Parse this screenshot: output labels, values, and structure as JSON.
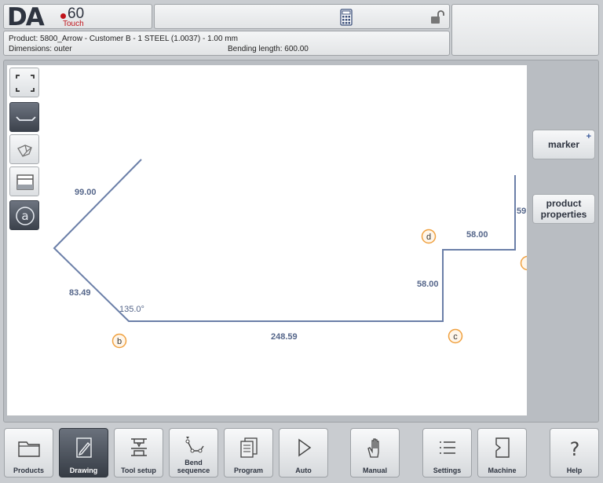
{
  "header": {
    "logo_da": "DA",
    "logo_num": "60",
    "logo_touch": "Touch"
  },
  "info": {
    "product_line": "Product: 5800_Arrow - Customer B - 1 STEEL (1.0037) - 1.00 mm",
    "dimensions": "Dimensions: outer",
    "bending_length": "Bending length: 600.00"
  },
  "drawing": {
    "dims": [
      "99.00",
      "83.49",
      "248.59",
      "58.00",
      "58.00",
      "59"
    ],
    "angle": "135.0°",
    "markers": [
      "b",
      "c",
      "d"
    ]
  },
  "side_buttons": {
    "marker": "marker",
    "marker_plus": "+",
    "props_line1": "product",
    "props_line2": "properties"
  },
  "nav": {
    "products": "Products",
    "drawing": "Drawing",
    "tool_setup": "Tool setup",
    "bend_seq_1": "Bend",
    "bend_seq_2": "sequence",
    "program": "Program",
    "auto": "Auto",
    "manual": "Manual",
    "settings": "Settings",
    "machine": "Machine",
    "help": "Help"
  },
  "colors": {
    "line": "#6b7fa8",
    "marker": "#f0a140",
    "active": "#3c424c"
  }
}
